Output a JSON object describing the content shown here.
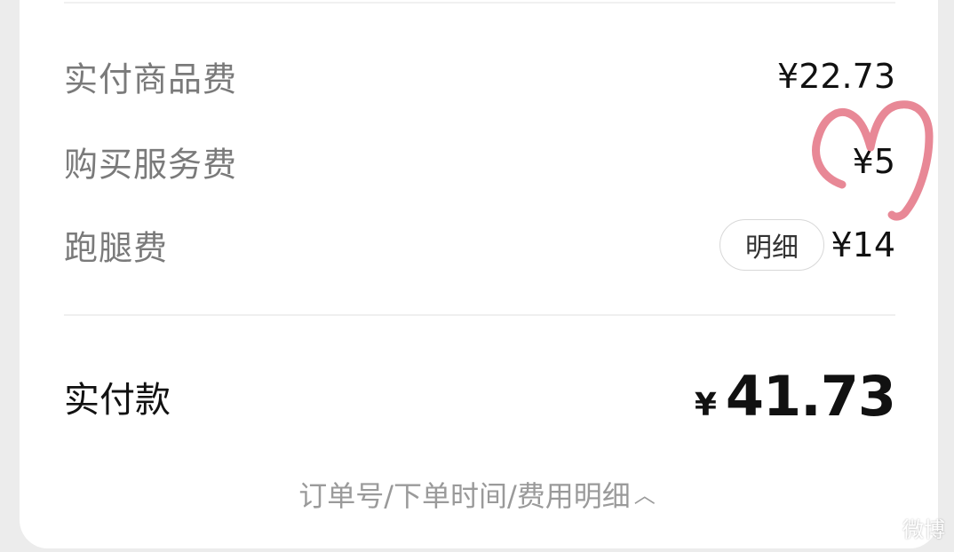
{
  "fees": [
    {
      "label": "实付商品费",
      "value": "¥22.73"
    },
    {
      "label": "购买服务费",
      "value": "¥5"
    },
    {
      "label": "跑腿费",
      "value": "¥14",
      "detail_button": "明细"
    }
  ],
  "total": {
    "label": "实付款",
    "currency": "¥",
    "amount": "41.73"
  },
  "footer": {
    "link_text": "订单号/下单时间/费用明细",
    "caret": "^"
  },
  "annotation": {
    "color": "#e88896",
    "shape": "hand-drawn-m-icon"
  },
  "watermark": {
    "text": "微博"
  }
}
